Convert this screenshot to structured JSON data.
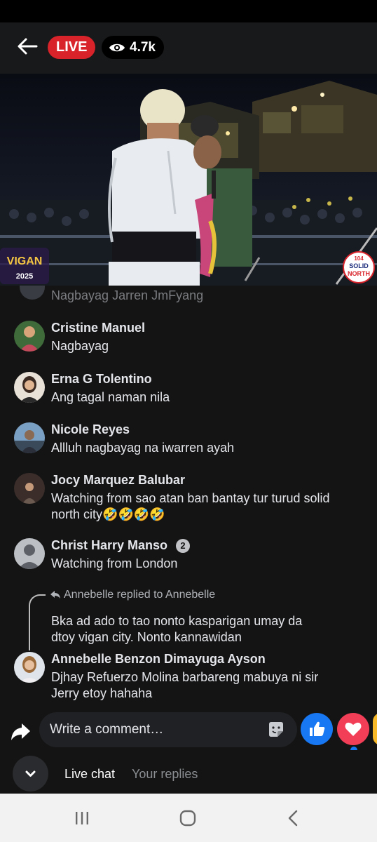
{
  "top_bar": {
    "live_label": "LIVE",
    "viewer_count": "4.7k"
  },
  "video": {
    "event_logo_text": "VIGAN",
    "event_logo_year": "2025",
    "station_logo": {
      "top": "104",
      "mid": "SOLID",
      "bottom": "NORTH"
    }
  },
  "comments": {
    "faded_previous": "Nagbayag Jarren JmFyang",
    "items": [
      {
        "name": "Cristine Manuel",
        "text": "Nagbayag"
      },
      {
        "name": "Erna G Tolentino",
        "text": "Ang tagal naman nila"
      },
      {
        "name": "Nicole Reyes",
        "text": "Allluh nagbayag na iwarren ayah"
      },
      {
        "name": "Jocy Marquez Balubar",
        "text_line1": "Watching from sao atan ban bantay tur turud solid",
        "text_line2": "north city🤣🤣🤣🤣"
      },
      {
        "name": "Christ Harry Manso",
        "badge": "2",
        "text": "Watching from London"
      },
      {
        "reply_label": "Annebelle replied to Annebelle",
        "quoted_line1": "Bka ad ado to tao nonto kasparigan umay da",
        "quoted_line2": "dtoy vigan city. Nonto kannawidan"
      },
      {
        "name": "Annebelle Benzon Dimayuga Ayson",
        "text_line1": "Djhay Refuerzo Molina barbareng mabuya ni sir",
        "text_line2": "Jerry etoy hahaha"
      }
    ]
  },
  "composer": {
    "placeholder": "Write a comment…",
    "tab_live_chat": "Live chat",
    "tab_your_replies": "Your replies"
  },
  "colors": {
    "live_red": "#d8232a",
    "like_blue": "#1877f2",
    "love_red": "#f33e58",
    "background": "#141414"
  },
  "icons": [
    "back-arrow-icon",
    "eye-icon",
    "share-icon",
    "sticker-icon",
    "like-icon",
    "love-icon",
    "chevron-down-icon",
    "recent-apps-icon",
    "home-icon",
    "back-nav-icon"
  ]
}
